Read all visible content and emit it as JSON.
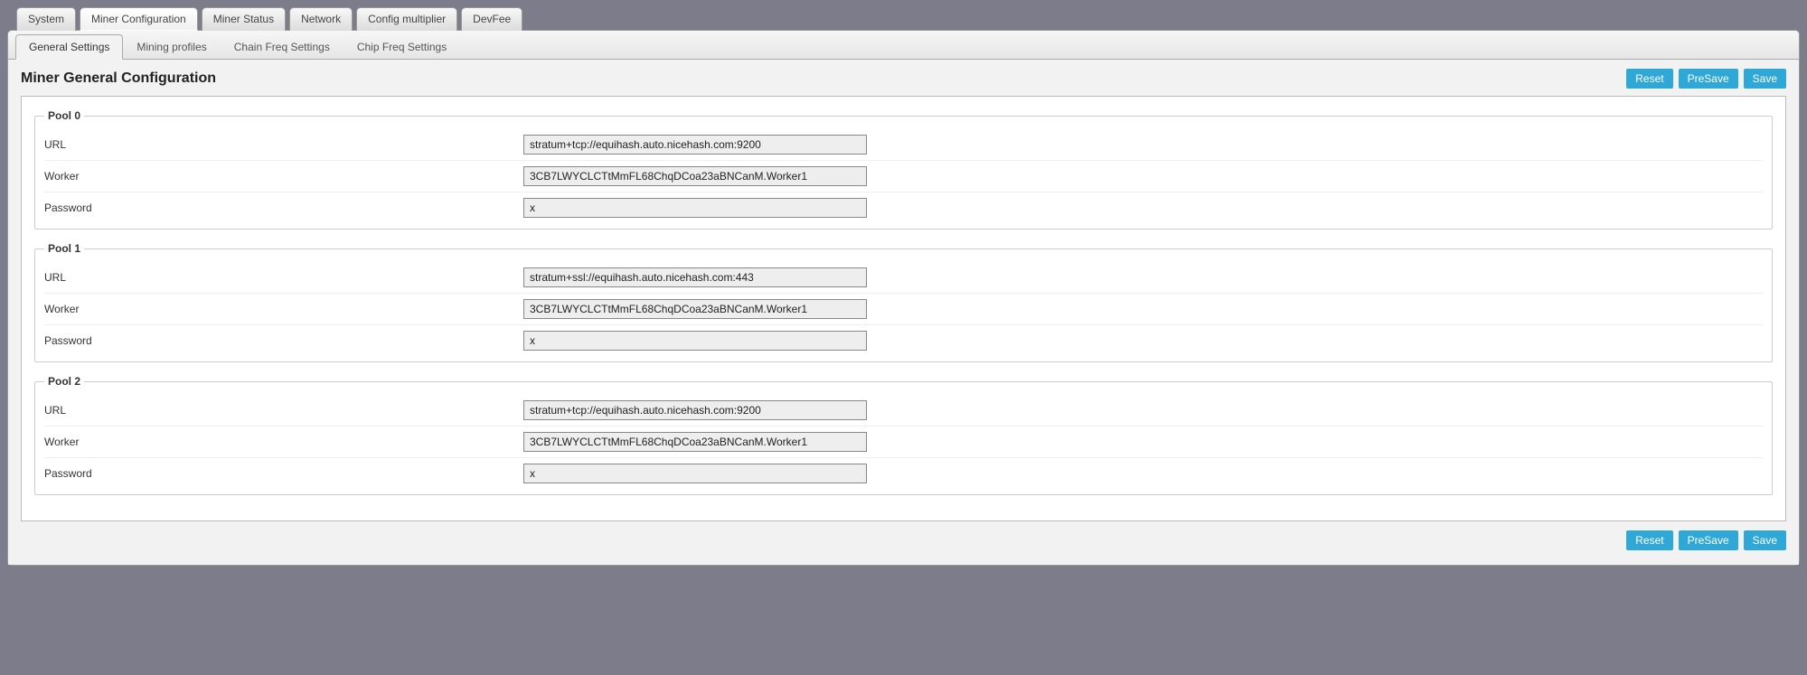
{
  "mainTabs": {
    "t0": "System",
    "t1": "Miner Configuration",
    "t2": "Miner Status",
    "t3": "Network",
    "t4": "Config multiplier",
    "t5": "DevFee"
  },
  "subTabs": {
    "s0": "General Settings",
    "s1": "Mining profiles",
    "s2": "Chain Freq Settings",
    "s3": "Chip Freq Settings"
  },
  "pageTitle": "Miner General Configuration",
  "buttons": {
    "reset": "Reset",
    "presave": "PreSave",
    "save": "Save"
  },
  "labels": {
    "url": "URL",
    "worker": "Worker",
    "password": "Password"
  },
  "pools": [
    {
      "legend": "Pool 0",
      "url": "stratum+tcp://equihash.auto.nicehash.com:9200",
      "worker": "3CB7LWYCLCTtMmFL68ChqDCoa23aBNCanM.Worker1",
      "password": "x"
    },
    {
      "legend": "Pool 1",
      "url": "stratum+ssl://equihash.auto.nicehash.com:443",
      "worker": "3CB7LWYCLCTtMmFL68ChqDCoa23aBNCanM.Worker1",
      "password": "x"
    },
    {
      "legend": "Pool 2",
      "url": "stratum+tcp://equihash.auto.nicehash.com:9200",
      "worker": "3CB7LWYCLCTtMmFL68ChqDCoa23aBNCanM.Worker1",
      "password": "x"
    }
  ]
}
